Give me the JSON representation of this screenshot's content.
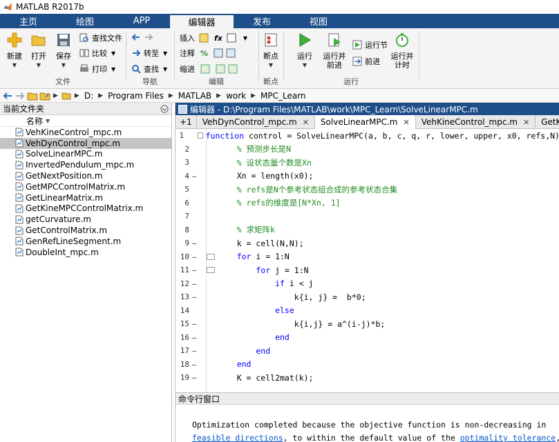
{
  "window": {
    "title": "MATLAB R2017b"
  },
  "tabs": [
    {
      "label": "主页",
      "active": false
    },
    {
      "label": "绘图",
      "active": false
    },
    {
      "label": "APP",
      "active": false
    },
    {
      "label": "编辑器",
      "active": true
    },
    {
      "label": "发布",
      "active": false
    },
    {
      "label": "视图",
      "active": false
    }
  ],
  "ribbon": {
    "file": {
      "new": "新建",
      "open": "打开",
      "save": "保存",
      "find_files": "查找文件",
      "compare": "比较",
      "print": "打印",
      "group": "文件"
    },
    "navigate": {
      "goto": "转至",
      "find": "查找",
      "group": "导航"
    },
    "edit": {
      "insert": "插入",
      "comment": "注释",
      "indent": "缩进",
      "fx": "fx",
      "group": "编辑"
    },
    "breakpoints": {
      "label": "断点",
      "group": "断点"
    },
    "run": {
      "run": "运行",
      "run_advance_l1": "运行并",
      "run_advance_l2": "前进",
      "run_section": "运行节",
      "advance": "前进",
      "run_time_l1": "运行并",
      "run_time_l2": "计时",
      "group": "运行"
    }
  },
  "address": {
    "drive": "D:",
    "crumbs": [
      "Program Files",
      "MATLAB",
      "work",
      "MPC_Learn"
    ]
  },
  "current_folder": {
    "title": "当前文件夹",
    "column": "名称",
    "files": [
      "VehKineControl_mpc.m",
      "VehDynControl_mpc.m",
      "SolveLinearMPC.m",
      "InvertedPendulum_mpc.m",
      "GetNextPosition.m",
      "GetMPCControlMatrix.m",
      "GetLinearMatrix.m",
      "GetKineMPCControlMatrix.m",
      "getCurvature.m",
      "GetControlMatrix.m",
      "GenRefLineSegment.m",
      "DoubleInt_mpc.m"
    ],
    "selected_index": 1
  },
  "editor": {
    "title": "编辑器 - D:\\Program Files\\MATLAB\\work\\MPC_Learn\\SolveLinearMPC.m",
    "tab_plus": "+1",
    "tabs": [
      "VehDynControl_mpc.m",
      "SolveLinearMPC.m",
      "VehKineControl_mpc.m",
      "GetKine"
    ],
    "active_tab": 1,
    "lines": [
      {
        "n": "1",
        "dash": false,
        "fold": true,
        "parts": [
          [
            "kw",
            "function"
          ],
          [
            "",
            " control = SolveLinearMPC(a, b, c, q, r, lower, upper, x0, refs,N)"
          ]
        ]
      },
      {
        "n": "2",
        "dash": false,
        "fold": false,
        "parts": [
          [
            "cm",
            "    % 预测步长是N"
          ]
        ]
      },
      {
        "n": "3",
        "dash": false,
        "fold": false,
        "parts": [
          [
            "cm",
            "    % 设状态量个数是Xn"
          ]
        ]
      },
      {
        "n": "4",
        "dash": true,
        "fold": false,
        "parts": [
          [
            "",
            "    Xn = length(x0);"
          ]
        ]
      },
      {
        "n": "5",
        "dash": false,
        "fold": false,
        "parts": [
          [
            "cm",
            "    % refs是N个参考状态组合成的参考状态合集"
          ]
        ]
      },
      {
        "n": "6",
        "dash": false,
        "fold": false,
        "parts": [
          [
            "cm",
            "    % refs的维度是[N*Xn, 1]"
          ]
        ]
      },
      {
        "n": "7",
        "dash": false,
        "fold": false,
        "parts": [
          [
            "",
            ""
          ]
        ]
      },
      {
        "n": "8",
        "dash": false,
        "fold": false,
        "parts": [
          [
            "cm",
            "    % 求矩阵k"
          ]
        ]
      },
      {
        "n": "9",
        "dash": true,
        "fold": false,
        "parts": [
          [
            "",
            "    k = cell(N,N);"
          ]
        ]
      },
      {
        "n": "10",
        "dash": true,
        "fold": true,
        "parts": [
          [
            "kw",
            "    for"
          ],
          [
            "",
            " i = 1:N"
          ]
        ]
      },
      {
        "n": "11",
        "dash": true,
        "fold": true,
        "parts": [
          [
            "kw",
            "        for"
          ],
          [
            "",
            " j = 1:N"
          ]
        ]
      },
      {
        "n": "12",
        "dash": true,
        "fold": false,
        "parts": [
          [
            "kw",
            "            if"
          ],
          [
            "",
            " i < j"
          ]
        ]
      },
      {
        "n": "13",
        "dash": true,
        "fold": false,
        "parts": [
          [
            "",
            "                k{i, j} =  b*0;"
          ]
        ]
      },
      {
        "n": "14",
        "dash": false,
        "fold": false,
        "parts": [
          [
            "kw",
            "            else"
          ]
        ]
      },
      {
        "n": "15",
        "dash": true,
        "fold": false,
        "parts": [
          [
            "",
            "                k{i,j} = a^(i-j)*b;"
          ]
        ]
      },
      {
        "n": "16",
        "dash": true,
        "fold": false,
        "parts": [
          [
            "kw",
            "            end"
          ]
        ]
      },
      {
        "n": "17",
        "dash": true,
        "fold": false,
        "parts": [
          [
            "kw",
            "        end"
          ]
        ]
      },
      {
        "n": "18",
        "dash": true,
        "fold": false,
        "parts": [
          [
            "kw",
            "    end"
          ]
        ]
      },
      {
        "n": "19",
        "dash": true,
        "fold": false,
        "parts": [
          [
            "",
            "    K = cell2mat(k);"
          ]
        ]
      }
    ]
  },
  "command_window": {
    "title": "命令行窗口",
    "line1": "Optimization completed because the objective function is non-decreasing in",
    "link1": "feasible directions",
    "line2_mid": ", to within the default value of the ",
    "link2": "optimality tolerance",
    "line2_end": ","
  },
  "colors": {
    "accent": "#1e4f8a",
    "keyword": "#0000ff",
    "comment": "#228b22",
    "selected_row": "#c4c4c4"
  }
}
